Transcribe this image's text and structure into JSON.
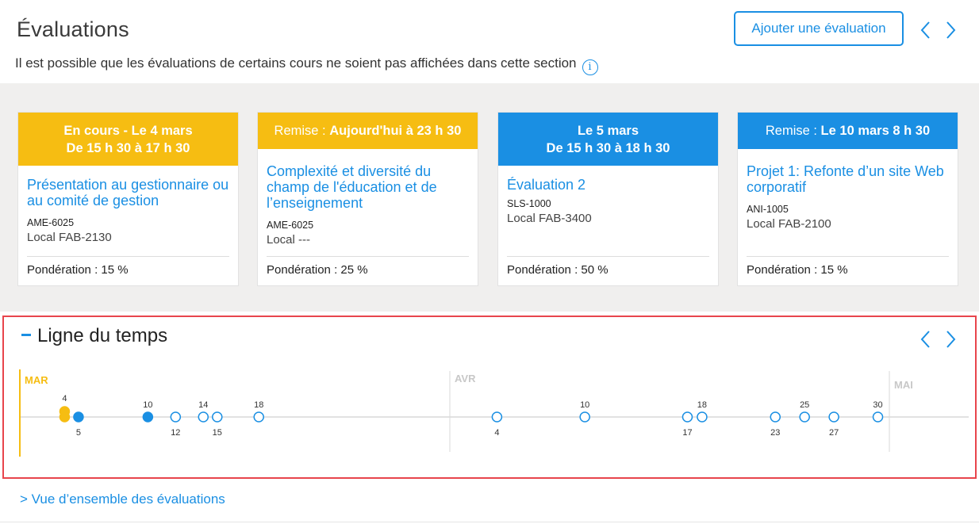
{
  "header": {
    "title": "Évaluations",
    "subtitle": "Il est possible que les évaluations de certains cours ne soient pas affichées dans cette section",
    "info_icon": "info-icon",
    "add_button": "Ajouter une évaluation"
  },
  "cards": [
    {
      "head_line1": "En cours - Le 4 mars",
      "head_line2": "De 15 h 30 à 17 h 30",
      "title": "Présentation au gestionnaire ou au comité de gestion",
      "code": "AME-6025",
      "local": "Local FAB-2130",
      "weight": "Pondération : 15 %",
      "color": "#f6bd12"
    },
    {
      "head_prefix": "Remise : ",
      "head_bold": "Aujourd'hui à 23 h 30",
      "title": "Complexité et diversité du champ de l'éducation et de l’enseignement",
      "code": "AME-6025",
      "local": "Local ---",
      "weight": "Pondération : 25 %",
      "color": "#f6bd12"
    },
    {
      "head_line1": "Le 5 mars",
      "head_line2": "De 15 h 30 à 18 h 30",
      "title": "Évaluation 2",
      "code": "SLS-1000",
      "local": "Local FAB-3400",
      "weight": "Pondération : 50 %",
      "color": "#1a8fe3"
    },
    {
      "head_prefix": "Remise : ",
      "head_bold": "Le 10 mars 8 h 30",
      "title": "Projet 1: Refonte d’un site Web corporatif",
      "code": "ANI-1005",
      "local": "Local FAB-2100",
      "weight": "Pondération : 15 %",
      "color": "#1a8fe3"
    }
  ],
  "timeline": {
    "title": "Ligne du temps",
    "months": [
      "MAR",
      "AVR",
      "MAI"
    ],
    "events": [
      {
        "month": "MAR",
        "day": 4,
        "label": "4",
        "state": "current",
        "label_pos": "above",
        "stacked": true
      },
      {
        "month": "MAR",
        "day": 5,
        "label": "5",
        "state": "filled",
        "label_pos": "below"
      },
      {
        "month": "MAR",
        "day": 10,
        "label": "10",
        "state": "filled",
        "label_pos": "above"
      },
      {
        "month": "MAR",
        "day": 12,
        "label": "12",
        "state": "open",
        "label_pos": "below"
      },
      {
        "month": "MAR",
        "day": 14,
        "label": "14",
        "state": "open",
        "label_pos": "above"
      },
      {
        "month": "MAR",
        "day": 15,
        "label": "15",
        "state": "open",
        "label_pos": "below"
      },
      {
        "month": "MAR",
        "day": 18,
        "label": "18",
        "state": "open",
        "label_pos": "above"
      },
      {
        "month": "AVR",
        "day": 4,
        "label": "4",
        "state": "open",
        "label_pos": "below"
      },
      {
        "month": "AVR",
        "day": 10,
        "label": "10",
        "state": "open",
        "label_pos": "above"
      },
      {
        "month": "AVR",
        "day": 17,
        "label": "17",
        "state": "open",
        "label_pos": "below"
      },
      {
        "month": "AVR",
        "day": 18,
        "label": "18",
        "state": "open",
        "label_pos": "above"
      },
      {
        "month": "AVR",
        "day": 23,
        "label": "23",
        "state": "open",
        "label_pos": "below"
      },
      {
        "month": "AVR",
        "day": 25,
        "label": "25",
        "state": "open",
        "label_pos": "above"
      },
      {
        "month": "AVR",
        "day": 27,
        "label": "27",
        "state": "open",
        "label_pos": "below"
      },
      {
        "month": "AVR",
        "day": 30,
        "label": "30",
        "state": "open",
        "label_pos": "above"
      }
    ],
    "colors": {
      "current": "#f6bd12",
      "accent": "#1a8fe3",
      "axis": "#d9d9d9",
      "month_inactive": "#c8c8c8"
    }
  },
  "footer": {
    "overview_link": "> Vue d’ensemble des évaluations"
  }
}
